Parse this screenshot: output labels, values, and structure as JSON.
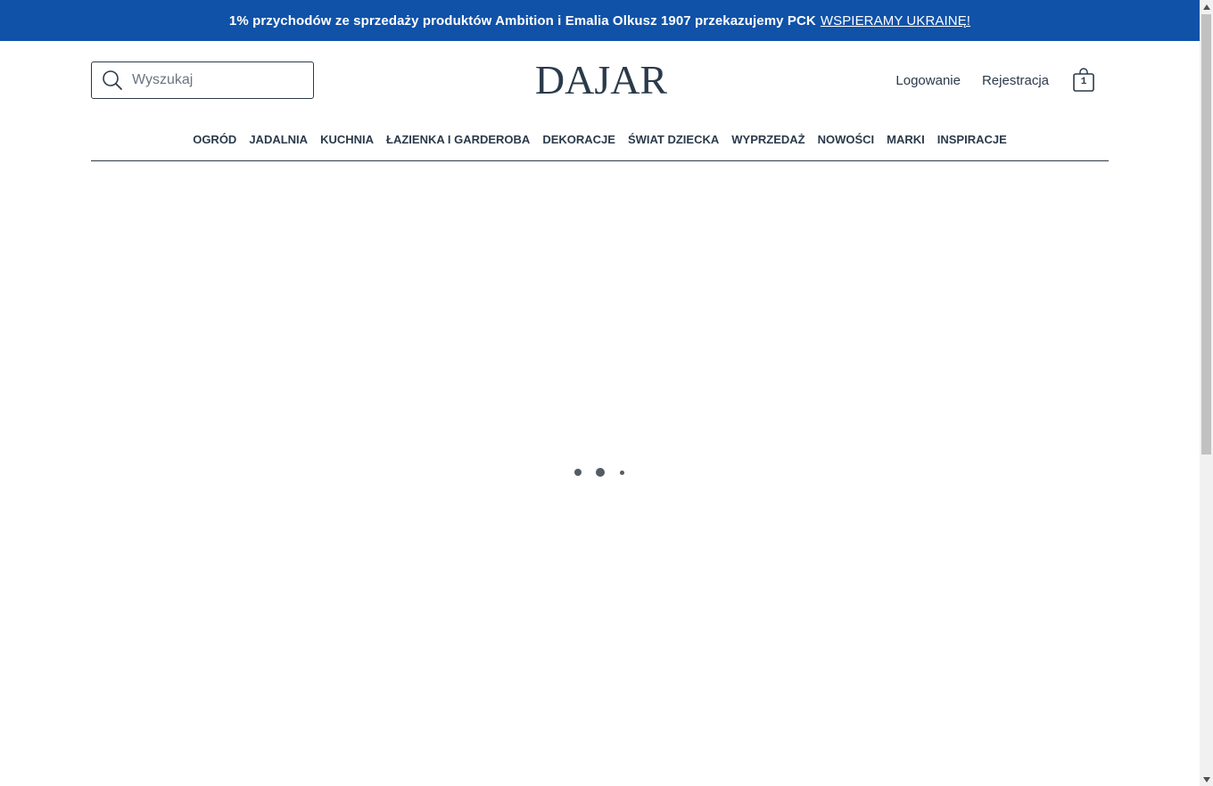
{
  "promo": {
    "text": "1% przychodów ze sprzedaży produktów Ambition i Emalia Olkusz 1907 przekazujemy PCK",
    "link": "WSPIERAMY UKRAINĘ!",
    "bg_color": "#0f52a8"
  },
  "search": {
    "placeholder": "Wyszukaj",
    "value": "",
    "icon": "search-icon"
  },
  "logo": {
    "text": "DAJAR"
  },
  "header": {
    "login_label": "Logowanie",
    "register_label": "Rejestracja",
    "cart_icon": "shopping-bag-icon",
    "cart_count": "1"
  },
  "nav": {
    "items": [
      {
        "label": "OGRÓD"
      },
      {
        "label": "JADALNIA"
      },
      {
        "label": "KUCHNIA"
      },
      {
        "label": "ŁAZIENKA I GARDEROBA"
      },
      {
        "label": "DEKORACJE"
      },
      {
        "label": "ŚWIAT DZIECKA"
      },
      {
        "label": "WYPRZEDAŻ"
      },
      {
        "label": "NOWOŚCI"
      },
      {
        "label": "MARKI"
      },
      {
        "label": "INSPIRACJE"
      }
    ]
  },
  "loader": {
    "icon": "loading-dots-icon",
    "color": "#555c63"
  },
  "theme": {
    "text_color": "#2b3a4a",
    "background": "#ffffff"
  }
}
